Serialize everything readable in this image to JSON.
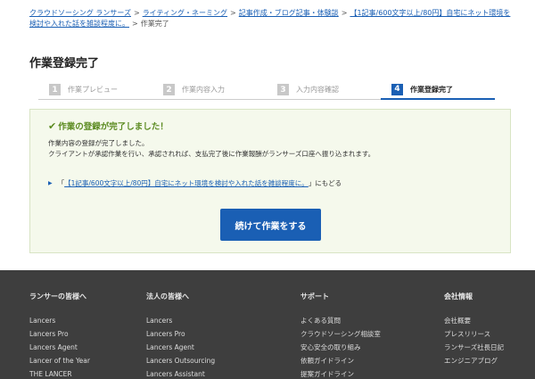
{
  "breadcrumb": {
    "items": [
      "クラウドソーシング ランサーズ",
      "ライティング・ネーミング",
      "記事作成・ブログ記事・体験談",
      "【1記事/600文字以上/80円】自宅にネット環境を検討や入れた話を雑談程度に。"
    ],
    "current": "作業完了",
    "sep": ">"
  },
  "page": {
    "title": "作業登録完了"
  },
  "steps": [
    {
      "num": "1",
      "label": "作業プレビュー"
    },
    {
      "num": "2",
      "label": "作業内容入力"
    },
    {
      "num": "3",
      "label": "入力内容確認"
    },
    {
      "num": "4",
      "label": "作業登録完了"
    }
  ],
  "panel": {
    "check_icon": "✔",
    "title": "作業の登録が完了しました！",
    "line1": "作業内容の登録が完了しました。",
    "line2": "クライアントが承認作業を行い、承認されれば、支払完了後に作業報酬がランサーズ口座へ振り込まれます。",
    "back_link_pre": "「",
    "back_link_text": "【1記事/600文字以上/80円】自宅にネット環境を検討や入れた話を雑談程度に。",
    "back_link_post": "」にもどる",
    "button_label": "続けて作業をする"
  },
  "footer": {
    "columns": [
      {
        "heading": "ランサーの皆様へ",
        "items": [
          "Lancers",
          "Lancers Pro",
          "Lancers Agent",
          "Lancer of the Year",
          "THE LANCER"
        ]
      },
      {
        "heading": "法人の皆様へ",
        "items": [
          "Lancers",
          "Lancers Pro",
          "Lancers Agent",
          "Lancers Outsourcing",
          "Lancers Assistant"
        ]
      },
      {
        "heading": "サポート",
        "items": [
          "よくある質問",
          "クラウドソーシング相談室",
          "安心安全の取り組み",
          "依頼ガイドライン",
          "提案ガイドライン"
        ]
      },
      {
        "heading": "会社情報",
        "items": [
          "会社概要",
          "プレスリリース",
          "ランサーズ社長日記",
          "エンジニアブログ"
        ]
      }
    ]
  },
  "colors": {
    "accent": "#1a5fb4",
    "success": "#5a8a1f",
    "footer_bg": "#3e3e3e"
  }
}
